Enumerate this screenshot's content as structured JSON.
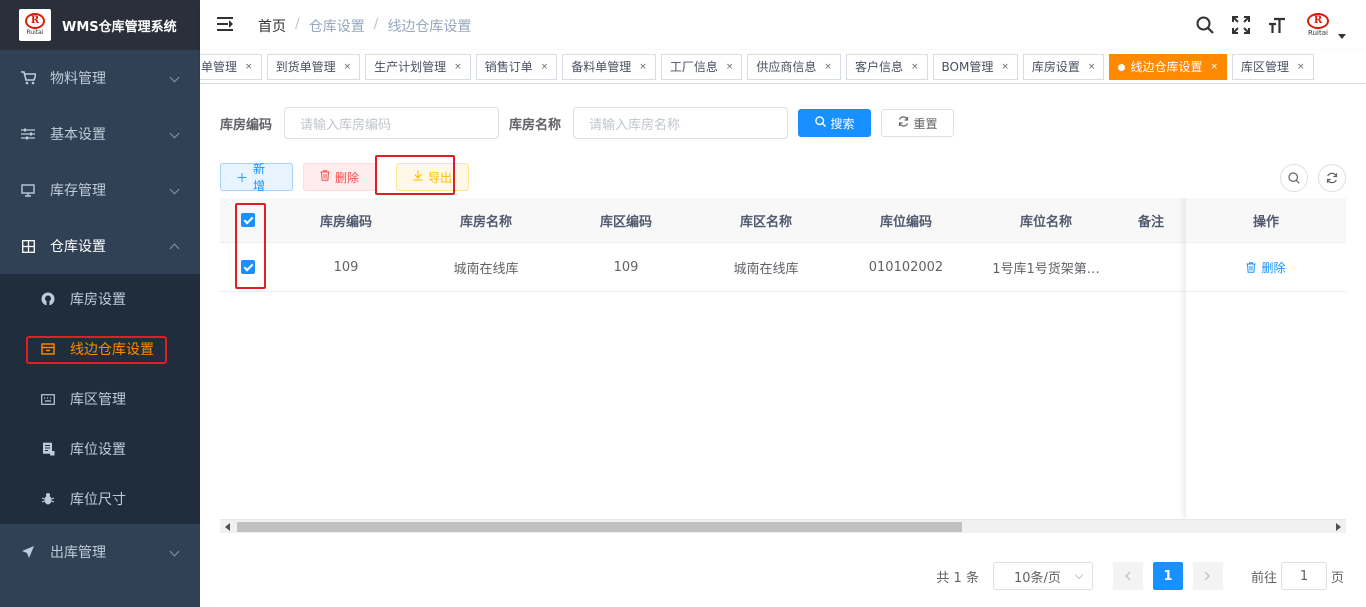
{
  "app": {
    "title": "WMS仓库管理系统",
    "logo_text": "Ruitai",
    "logo_letter": "R"
  },
  "sidebar": {
    "items": [
      {
        "label": "物料管理",
        "icon": "cart-icon"
      },
      {
        "label": "基本设置",
        "icon": "sliders-icon"
      },
      {
        "label": "库存管理",
        "icon": "monitor-icon"
      },
      {
        "label": "仓库设置",
        "icon": "grid-icon",
        "open": true
      },
      {
        "label": "出库管理",
        "icon": "send-icon"
      }
    ],
    "submenu": [
      {
        "label": "库房设置",
        "icon": "github-icon"
      },
      {
        "label": "线边仓库设置",
        "icon": "box-icon",
        "active": true
      },
      {
        "label": "库区管理",
        "icon": "keyboard-icon"
      },
      {
        "label": "库位设置",
        "icon": "document-icon"
      },
      {
        "label": "库位尺寸",
        "icon": "bug-icon"
      }
    ]
  },
  "navbar": {
    "breadcrumb": [
      "首页",
      "仓库设置",
      "线边仓库设置"
    ],
    "avatar_text": "Ruitai"
  },
  "tags": [
    {
      "label": "单管理"
    },
    {
      "label": "到货单管理"
    },
    {
      "label": "生产计划管理"
    },
    {
      "label": "销售订单"
    },
    {
      "label": "备料单管理"
    },
    {
      "label": "工厂信息"
    },
    {
      "label": "供应商信息"
    },
    {
      "label": "客户信息"
    },
    {
      "label": "BOM管理"
    },
    {
      "label": "库房设置"
    },
    {
      "label": "线边仓库设置",
      "active": true
    },
    {
      "label": "库区管理"
    }
  ],
  "search": {
    "field1_label": "库房编码",
    "field1_placeholder": "请输入库房编码",
    "field2_label": "库房名称",
    "field2_placeholder": "请输入库房名称",
    "search_label": "搜索",
    "reset_label": "重置"
  },
  "actions": {
    "add_label": "新增",
    "delete_label": "删除",
    "export_label": "导出"
  },
  "table": {
    "columns": [
      "库房编码",
      "库房名称",
      "库区编码",
      "库区名称",
      "库位编码",
      "库位名称",
      "备注",
      "操作"
    ],
    "rows": [
      {
        "warehouse_code": "109",
        "warehouse_name": "城南在线库",
        "area_code": "109",
        "area_name": "城南在线库",
        "location_code": "010102002",
        "location_name": "1号库1号货架第…",
        "remark": "",
        "op_label": "删除"
      }
    ]
  },
  "pagination": {
    "total": "共 1 条",
    "page_size": "10条/页",
    "current": "1",
    "goto_label": "前往",
    "goto_value": "1",
    "page_unit": "页"
  },
  "colors": {
    "sidebar_bg": "#304156",
    "active_orange": "#ff8a00",
    "primary": "#1890ff",
    "highlight_red": "#e02020"
  }
}
